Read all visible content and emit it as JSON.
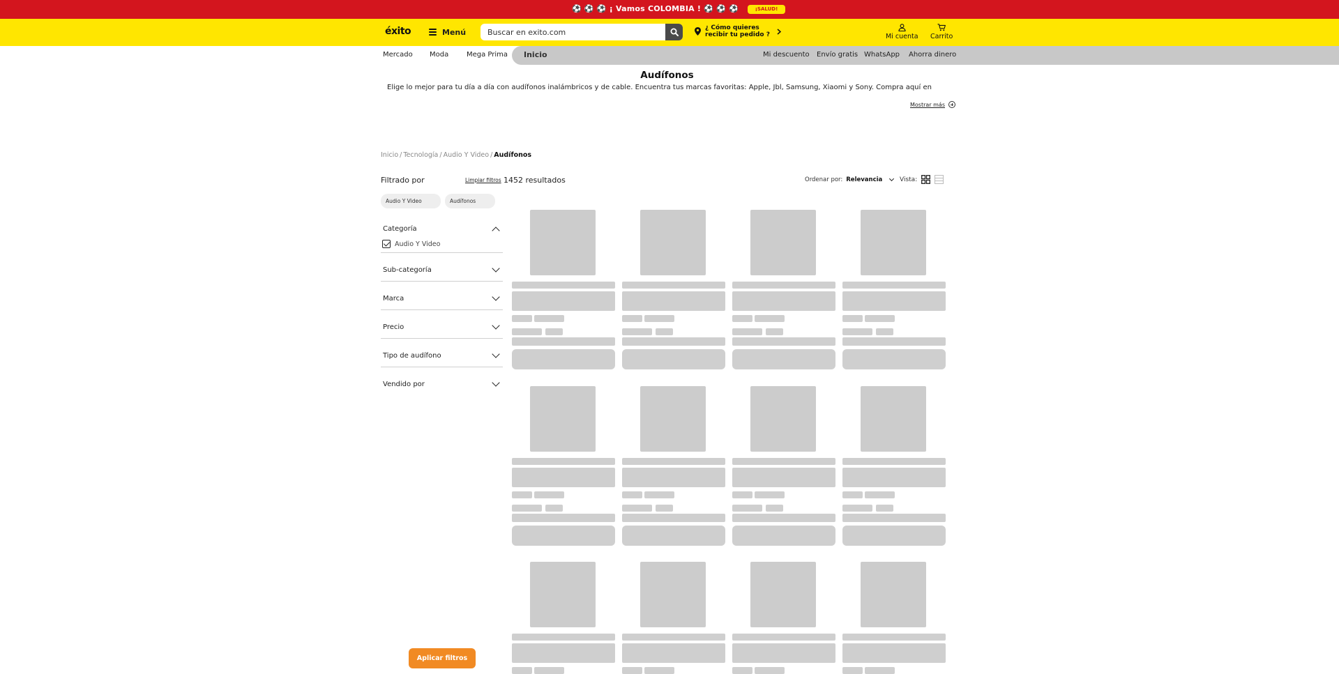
{
  "promo": {
    "text": "⚽ ⚽ ⚽ ¡ Vamos COLOMBIA ! ⚽ ⚽ ⚽",
    "badge": "¡SALUD!"
  },
  "header": {
    "logo": "éxito",
    "menu_label": "Menú",
    "search_placeholder": "Buscar en exito.com",
    "delivery_line1": "¿ Cómo quieres",
    "delivery_line2": "recibir tu pedido ?",
    "account_label": "Mi cuenta",
    "cart_label": "Carrito"
  },
  "nav": {
    "left": [
      "Mercado",
      "Moda",
      "Mega Prima"
    ],
    "active": "Inicio",
    "right": [
      "Mi descuento",
      "Envío gratis",
      "WhatsApp",
      "Ahorra dinero"
    ]
  },
  "category": {
    "title": "Audífonos",
    "description": "Elige lo mejor para tu día a día con audífonos inalámbricos y de cable. Encuentra tus marcas favoritas: Apple, Jbl, Samsung, Xiaomi y Sony. Compra aquí en",
    "show_more": "Mostrar más"
  },
  "breadcrumb": [
    "Inicio",
    "Tecnología",
    "Audio Y Video",
    "Audífonos"
  ],
  "filters": {
    "title": "Filtrado por",
    "clear": "Limpiar filtros",
    "results": "1452 resultados",
    "chips": [
      "Audio Y Video",
      "Audífonos"
    ],
    "facets": [
      "Categoría",
      "Sub-categoría",
      "Marca",
      "Precio",
      "Tipo de audífono",
      "Vendido por"
    ],
    "category_option": "Audio Y Video",
    "apply": "Aplicar filtros"
  },
  "sort": {
    "label": "Ordenar por:",
    "value": "Relevancia"
  },
  "view": {
    "label": "Vista:"
  },
  "colors": {
    "red": "#d3151e",
    "yellow": "#ffe600",
    "orange": "#f18a23",
    "skeleton": "#cfcfcf",
    "nav_gray": "#c8c8c8"
  }
}
